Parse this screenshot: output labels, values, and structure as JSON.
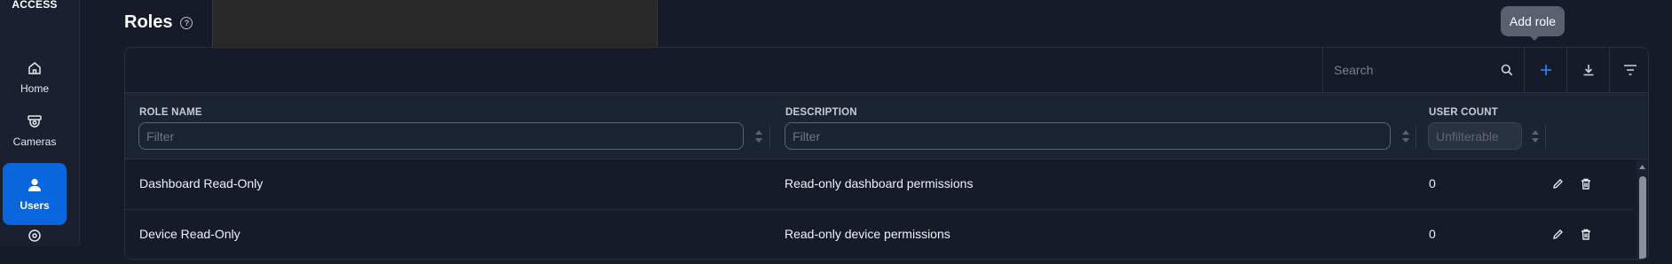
{
  "sidebar": {
    "brand": "ACCESS",
    "items": [
      {
        "label": "Home",
        "icon": "home-icon"
      },
      {
        "label": "Cameras",
        "icon": "camera-icon"
      },
      {
        "label": "Users",
        "icon": "user-icon",
        "active": true
      }
    ]
  },
  "page": {
    "title": "Roles",
    "help_icon": "?"
  },
  "toolbar": {
    "search_placeholder": "Search",
    "add_tooltip": "Add role"
  },
  "table": {
    "columns": [
      {
        "label": "ROLE NAME",
        "filter_placeholder": "Filter"
      },
      {
        "label": "DESCRIPTION",
        "filter_placeholder": "Filter"
      },
      {
        "label": "USER COUNT",
        "filter_placeholder": "Unfilterable"
      }
    ],
    "rows": [
      {
        "name": "Dashboard Read-Only",
        "description": "Read-only dashboard permissions",
        "count": "0"
      },
      {
        "name": "Device Read-Only",
        "description": "Read-only device permissions",
        "count": "0"
      }
    ]
  },
  "colors": {
    "accent": "#0a66dd",
    "background": "#151b28",
    "sidebar": "#1a2030",
    "tooltip": "#5a6070"
  }
}
